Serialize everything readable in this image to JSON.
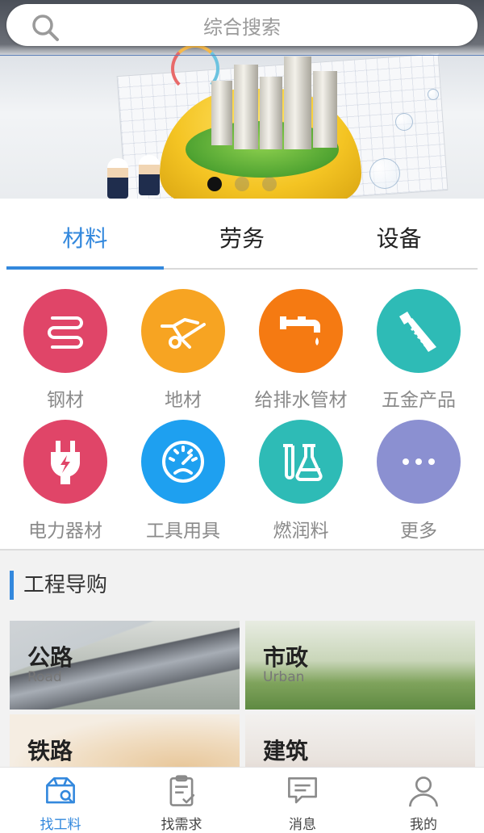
{
  "search": {
    "placeholder": "综合搜索"
  },
  "banner": {
    "slides": 3,
    "active_slide": 1
  },
  "tabs": [
    {
      "label": "材料",
      "active": true
    },
    {
      "label": "劳务",
      "active": false
    },
    {
      "label": "设备",
      "active": false
    }
  ],
  "categories": [
    {
      "label": "钢材",
      "icon": "steel-coil-icon",
      "color": "#e04568"
    },
    {
      "label": "地材",
      "icon": "wheelbarrow-icon",
      "color": "#f7a422"
    },
    {
      "label": "给排水管材",
      "icon": "water-pipe-icon",
      "color": "#f57a12"
    },
    {
      "label": "五金产品",
      "icon": "saw-icon",
      "color": "#2ebbb6"
    },
    {
      "label": "电力器材",
      "icon": "power-plug-icon",
      "color": "#e04568"
    },
    {
      "label": "工具用具",
      "icon": "gauge-icon",
      "color": "#1ea0f0"
    },
    {
      "label": "燃润料",
      "icon": "flask-icon",
      "color": "#2ebbb6"
    },
    {
      "label": "更多",
      "icon": "more-icon",
      "color": "#8b90d1"
    }
  ],
  "section": {
    "title": "工程导购"
  },
  "guide_cards": [
    {
      "title": "公路",
      "subtitle": "Road"
    },
    {
      "title": "市政",
      "subtitle": "Urban"
    },
    {
      "title": "铁路",
      "subtitle": ""
    },
    {
      "title": "建筑",
      "subtitle": ""
    }
  ],
  "bottom_nav": [
    {
      "label": "找工料",
      "icon": "box-search-icon",
      "active": true
    },
    {
      "label": "找需求",
      "icon": "clipboard-check-icon",
      "active": false
    },
    {
      "label": "消息",
      "icon": "message-icon",
      "active": false
    },
    {
      "label": "我的",
      "icon": "user-icon",
      "active": false
    }
  ],
  "colors": {
    "accent": "#3388dd",
    "muted_text": "#8a8a8a"
  }
}
